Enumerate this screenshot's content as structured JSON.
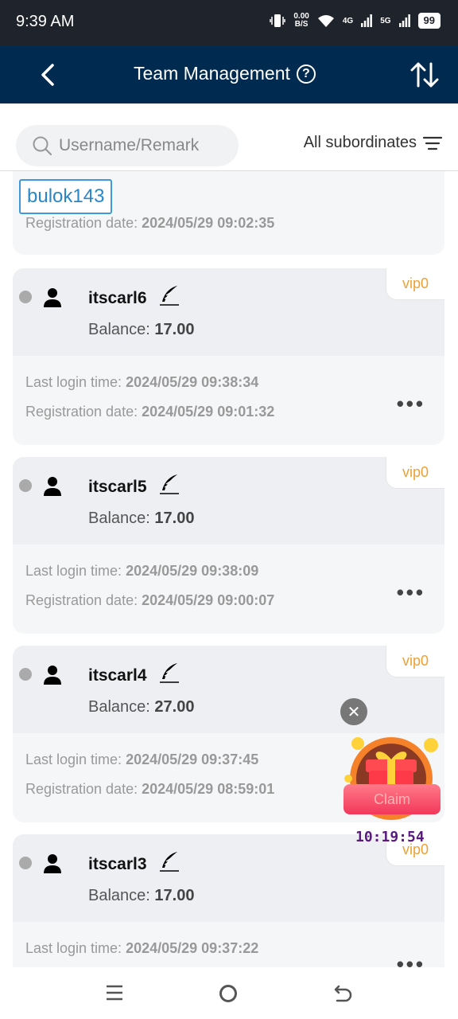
{
  "status_bar": {
    "time": "9:39 AM",
    "net_speed_top": "0.00",
    "net_speed_bottom": "B/S",
    "sig1": "4G",
    "sig2": "5G",
    "battery": "99"
  },
  "header": {
    "title": "Team Management",
    "help_icon": "?"
  },
  "search": {
    "placeholder": "Username/Remark",
    "filter_label": "All subordinates"
  },
  "partial_card": {
    "tag": "bulok143",
    "registration_label": "Registration date:",
    "registration_value": "2024/05/29 09:02:35"
  },
  "labels": {
    "balance": "Balance:",
    "last_login": "Last login time:",
    "registration": "Registration date:",
    "more": "•••"
  },
  "members": [
    {
      "username": "itscarl6",
      "vip": "vip0",
      "balance": "17.00",
      "last_login": "2024/05/29 09:38:34",
      "registration": "2024/05/29 09:01:32"
    },
    {
      "username": "itscarl5",
      "vip": "vip0",
      "balance": "17.00",
      "last_login": "2024/05/29 09:38:09",
      "registration": "2024/05/29 09:00:07"
    },
    {
      "username": "itscarl4",
      "vip": "vip0",
      "balance": "27.00",
      "last_login": "2024/05/29 09:37:45",
      "registration": "2024/05/29 08:59:01"
    },
    {
      "username": "itscarl3",
      "vip": "vip0",
      "balance": "17.00",
      "last_login": "2024/05/29 09:37:22",
      "registration": ""
    }
  ],
  "claim_widget": {
    "close": "✕",
    "claim_label": "Claim",
    "timer": "10:19:54"
  }
}
